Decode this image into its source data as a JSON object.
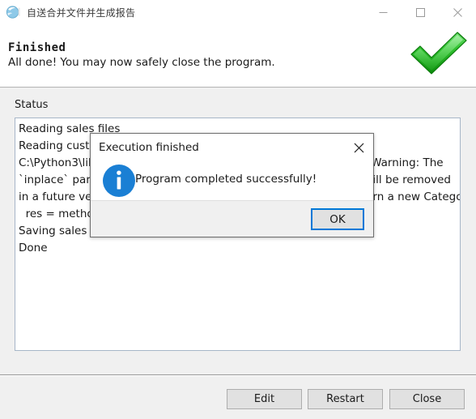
{
  "window": {
    "title": "自送合并文件并生成报告",
    "icon": "app-globe-icon",
    "controls": {
      "minimize": "minimize-icon",
      "maximize": "maximize-icon",
      "close": "close-icon"
    }
  },
  "header": {
    "heading": "Finished",
    "subtext": "All done! You may now safely close the program.",
    "status_icon": "green-checkmark-icon"
  },
  "main": {
    "status_label": "Status",
    "status_lines": [
      "Reading sales files",
      "Reading customer files",
      "C:\\Python3\\lib\\site-packages\\pandas\\core\\frame.py:4308: FutureWarning: The",
      "`inplace` parameter in pandas.Categorical.remove_categories will be removed",
      "in a future version. Removing unused categories will always return a new Categorical object.",
      "  res = method(*args, **kwargs)",
      "Saving sales and customer summary data",
      "Done"
    ]
  },
  "footer": {
    "buttons": [
      {
        "label": "Edit",
        "name": "edit-button"
      },
      {
        "label": "Restart",
        "name": "restart-button"
      },
      {
        "label": "Close",
        "name": "close-button"
      }
    ]
  },
  "dialog": {
    "title": "Execution finished",
    "message": "Program completed successfully!",
    "icon": "info-icon",
    "close_icon": "close-icon",
    "ok_label": "OK"
  },
  "colors": {
    "accent": "#0078d7",
    "info_blue": "#1a7fd4",
    "check_green": "#2da32d",
    "panel": "#f0f0f0",
    "button_face": "#e1e1e1"
  }
}
